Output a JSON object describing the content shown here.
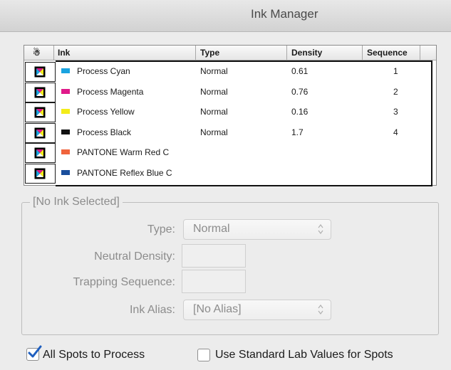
{
  "window": {
    "title": "Ink Manager"
  },
  "table": {
    "headers": {
      "icon_symbol": "☃",
      "ink": "Ink",
      "type": "Type",
      "density": "Density",
      "sequence": "Sequence"
    },
    "rows": [
      {
        "name": "Process Cyan",
        "type": "Normal",
        "density": "0.61",
        "sequence": "1",
        "swatch": "#1aa3e0"
      },
      {
        "name": "Process Magenta",
        "type": "Normal",
        "density": "0.76",
        "sequence": "2",
        "swatch": "#e01a8a"
      },
      {
        "name": "Process Yellow",
        "type": "Normal",
        "density": "0.16",
        "sequence": "3",
        "swatch": "#f3ec1a"
      },
      {
        "name": "Process Black",
        "type": "Normal",
        "density": "1.7",
        "sequence": "4",
        "swatch": "#111111"
      },
      {
        "name": "PANTONE Warm Red C",
        "type": "",
        "density": "",
        "sequence": "",
        "swatch": "#f0643c"
      },
      {
        "name": "PANTONE Reflex Blue C",
        "type": "",
        "density": "",
        "sequence": "",
        "swatch": "#1a4e9c"
      }
    ]
  },
  "ink_settings": {
    "group_title": "[No Ink Selected]",
    "type_label": "Type:",
    "type_value": "Normal",
    "neutral_density_label": "Neutral Density:",
    "neutral_density_value": "",
    "trapping_sequence_label": "Trapping Sequence:",
    "trapping_sequence_value": "",
    "ink_alias_label": "Ink Alias:",
    "ink_alias_value": "[No Alias]"
  },
  "options": {
    "all_spots_label": "All Spots to Process",
    "all_spots_checked": true,
    "lab_values_label": "Use Standard Lab Values for Spots",
    "lab_values_checked": false
  }
}
